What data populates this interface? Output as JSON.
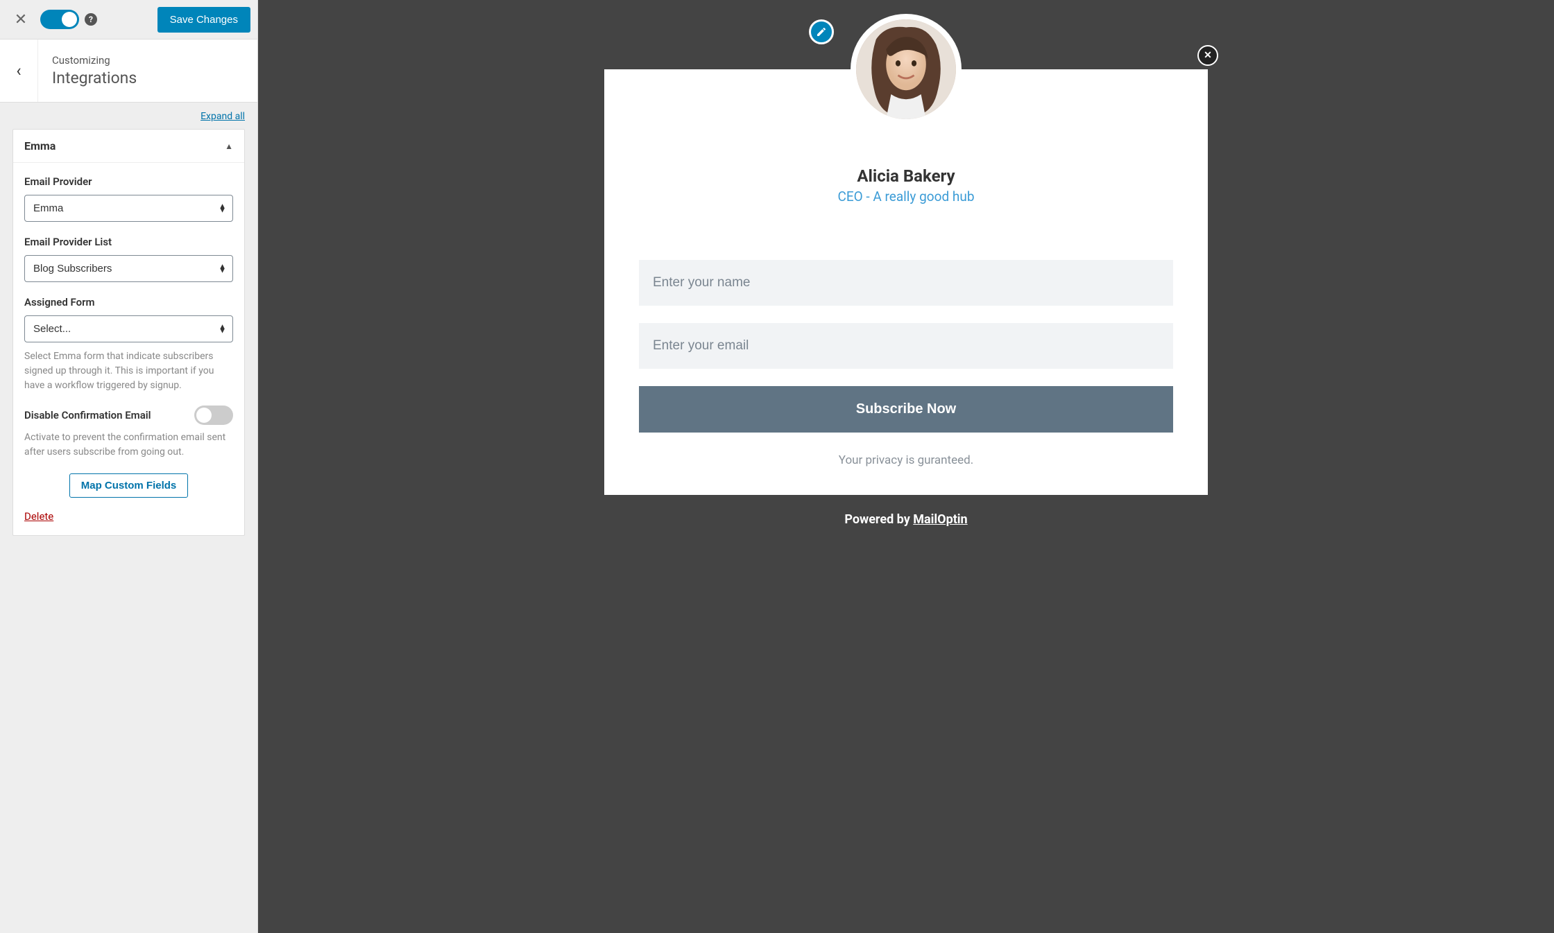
{
  "topbar": {
    "save_label": "Save Changes"
  },
  "header": {
    "customizing": "Customizing",
    "section": "Integrations"
  },
  "panel": {
    "expand_all": "Expand all",
    "accordion_title": "Emma",
    "email_provider_label": "Email Provider",
    "email_provider_value": "Emma",
    "list_label": "Email Provider List",
    "list_value": "Blog Subscribers",
    "assigned_form_label": "Assigned Form",
    "assigned_form_value": "Select...",
    "assigned_form_help": "Select Emma form that indicate subscribers signed up through it. This is important if you have a workflow triggered by signup.",
    "disable_confirm_label": "Disable Confirmation Email",
    "disable_confirm_help": "Activate to prevent the confirmation email sent after users subscribe from going out.",
    "map_custom_fields": "Map Custom Fields",
    "delete": "Delete"
  },
  "optin": {
    "name": "Alicia Bakery",
    "subtitle": "CEO - A really good hub",
    "name_placeholder": "Enter your name",
    "email_placeholder": "Enter your email",
    "subscribe": "Subscribe Now",
    "privacy": "Your privacy is guranteed.",
    "powered_prefix": "Powered by ",
    "powered_brand": "MailOptin"
  }
}
